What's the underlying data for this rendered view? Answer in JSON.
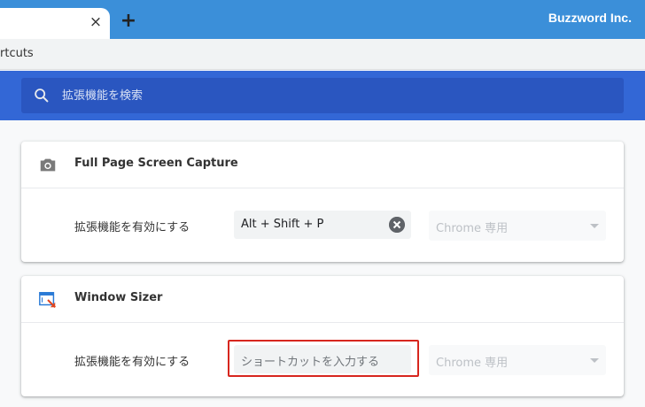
{
  "browser": {
    "tab_close_glyph": "×",
    "new_tab_glyph": "+",
    "watermark": "Buzzword Inc.",
    "bookmark_text": "rtcuts"
  },
  "header": {
    "search_placeholder": "拡張機能を検索",
    "colors": {
      "header": "#3367d6",
      "search": "#2a56c0",
      "tabstrip": "#3b8fd9"
    }
  },
  "extensions": [
    {
      "name": "Full Page Screen Capture",
      "icon": "camera-icon",
      "row_label": "拡張機能を有効にする",
      "shortcut_value": "Alt + Shift + P",
      "scope": "Chrome 専用"
    },
    {
      "name": "Window Sizer",
      "icon": "window-sizer-icon",
      "row_label": "拡張機能を有効にする",
      "shortcut_placeholder": "ショートカットを入力する",
      "scope": "Chrome 専用"
    }
  ],
  "highlight_color": "#d7261e"
}
